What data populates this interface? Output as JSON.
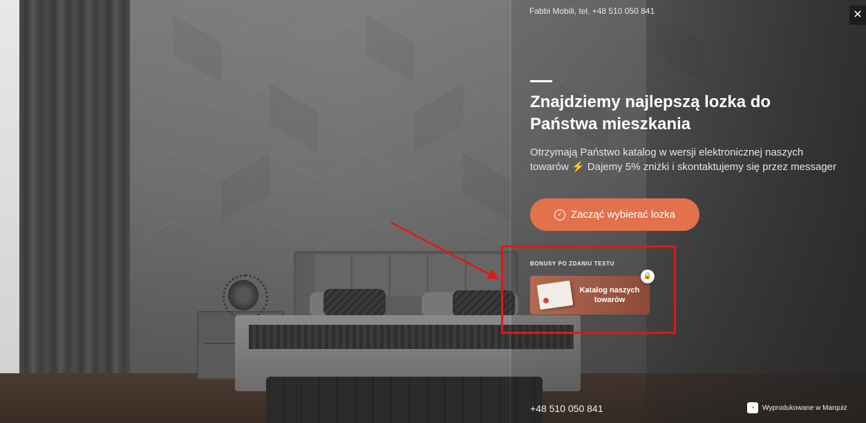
{
  "header": {
    "brand_contact": "Fabbi Mobili, tel. +48 510 050 841",
    "close_icon": "close-icon",
    "close_glyph": "✕"
  },
  "hero": {
    "headline": "Znajdziemy najlepszą lozka do Państwa mieszkania",
    "subtitle_part1": "Otrzymają Państwo katalog w wersji elektronicznej naszych towarów",
    "subtitle_icon": "⚡",
    "subtitle_part2": "Dajemy 5% zniżki i skontaktujemy się przez messager",
    "cta_icon": "check-circle-icon",
    "cta_glyph": "✓",
    "cta_label": "Zacząć wybierać lozka"
  },
  "bonuses": {
    "label": "BONUSY PO ZDANIU TESTU",
    "card_title": "Katalog naszych towarów",
    "lock_icon": "lock-icon",
    "lock_glyph": "🔒"
  },
  "footer": {
    "phone": "+48 510 050 841",
    "made_with": "Wyprodukowane w Marquiz",
    "marquiz_glyph": "◔"
  },
  "colors": {
    "accent": "#e3714b",
    "highlight": "#e81414",
    "annotation_arrow": "#e81414"
  }
}
